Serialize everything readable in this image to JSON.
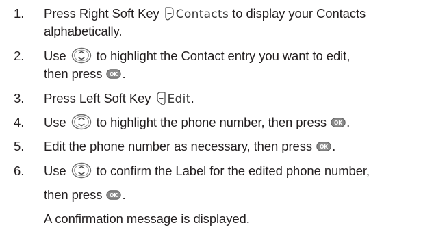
{
  "steps": [
    {
      "number": "1.",
      "line1_a": "Press Right Soft Key ",
      "line1_label": "Contacts",
      "line1_b": " to display your Contacts",
      "line2": "alphabetically."
    },
    {
      "number": "2.",
      "line1_a": "Use ",
      "line1_b": " to highlight the Contact entry you want to edit,",
      "line2_a": "then press ",
      "line2_b": "."
    },
    {
      "number": "3.",
      "line1_a": "Press Left Soft Key ",
      "line1_label": "Edit",
      "line1_b": "."
    },
    {
      "number": "4.",
      "line1_a": "Use ",
      "line1_b": " to highlight the phone number, then press ",
      "line1_c": "."
    },
    {
      "number": "5.",
      "line1_a": "Edit the phone number as necessary, then press ",
      "line1_b": "."
    },
    {
      "number": "6.",
      "line1_a": "Use ",
      "line1_b": " to confirm the Label for the edited phone number,",
      "line2_a": "then press ",
      "line2_b": ".",
      "line3": "A confirmation message is displayed."
    }
  ],
  "icons": {
    "nav": "navigation-key-icon",
    "ok": "ok-key-icon",
    "ok_label": "OK",
    "right_soft": "right-soft-key-icon",
    "left_soft": "left-soft-key-icon"
  },
  "colors": {
    "text": "#231f20",
    "icon_stroke": "#555555",
    "ok_fill": "#8a8a8a"
  }
}
